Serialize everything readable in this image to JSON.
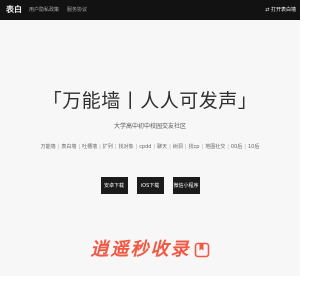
{
  "header": {
    "brand": "表白",
    "nav": [
      "用户隐私政策",
      "服务协议"
    ],
    "web_entry": "⇄ 打开表白墙"
  },
  "hero": {
    "slogan": "「万能墙丨人人可发声」",
    "subtitle": "大学高中初中校园交友社区",
    "tags": [
      "万能墙",
      "表白墙",
      "吐槽墙",
      "扩列",
      "找对象",
      "cpdd",
      "聊天",
      "树洞",
      "找cp",
      "地图社交",
      "00后",
      "10后"
    ],
    "buttons": [
      "安卓下载",
      "iOS下载",
      "微信小程序"
    ]
  },
  "watermark": {
    "text": "逍遥秒收录",
    "icon": "bookmark-icon",
    "color": "#f05a45"
  }
}
